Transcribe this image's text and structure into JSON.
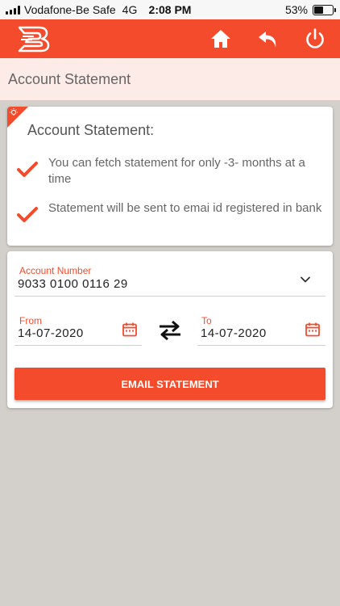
{
  "status_bar": {
    "carrier": "Vodafone-Be Safe",
    "network": "4G",
    "time": "2:08 PM",
    "battery": "53%",
    "battery_level": 0.53
  },
  "header": {
    "logo_icon": "bank-of-baroda-logo",
    "home_icon": "home-icon",
    "back_icon": "back-arrow-icon",
    "power_icon": "power-icon",
    "accent": "#f44b2c"
  },
  "page": {
    "title": "Account Statement"
  },
  "info": {
    "title": "Account Statement:",
    "items": [
      "You can fetch statement for only -3- months at a time",
      "Statement will be sent to emai id registered in bank"
    ]
  },
  "form": {
    "account_label": "Account Number",
    "account_value": "9033 0100 0116 29",
    "from_label": "From",
    "from_value": "14-07-2020",
    "to_label": "To",
    "to_value": "14-07-2020",
    "submit_label": "EMAIL STATEMENT"
  }
}
